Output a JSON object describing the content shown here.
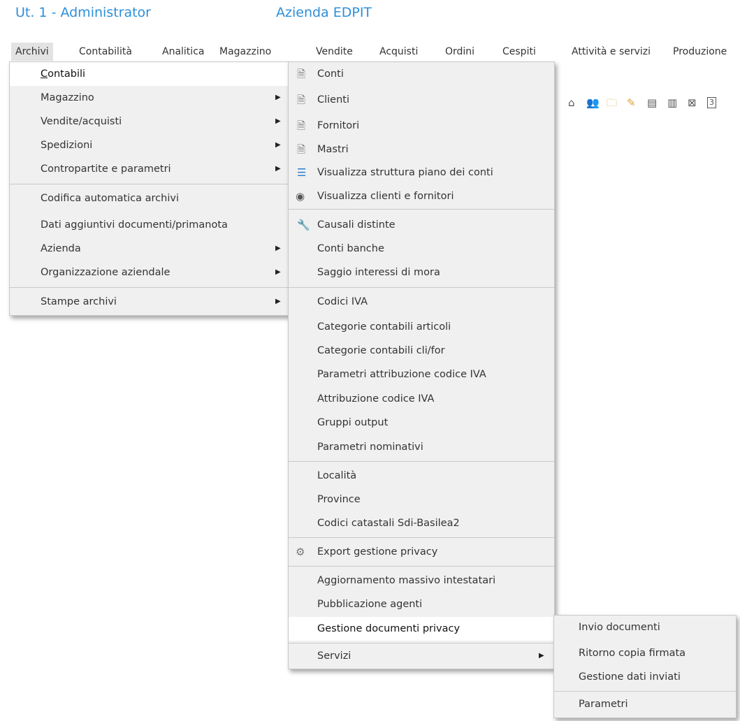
{
  "window": {
    "user_label": "Ut. 1 - Administrator",
    "company_label": "Azienda EDPIT"
  },
  "menubar": {
    "items": [
      {
        "label": "Archivi"
      },
      {
        "label": "Contabilità"
      },
      {
        "label": "Analitica"
      },
      {
        "label": "Magazzino"
      },
      {
        "label": "Vendite"
      },
      {
        "label": "Acquisti"
      },
      {
        "label": "Ordini"
      },
      {
        "label": "Cespiti"
      },
      {
        "label": "Attività e servizi"
      },
      {
        "label": "Produzione"
      }
    ],
    "active": "Archivi"
  },
  "toolbar": {
    "icons": [
      "home-icon",
      "users-icon",
      "search-folder-icon",
      "edit-icon",
      "calculator-icon",
      "barcode-icon",
      "print-icon",
      "calendar-icon"
    ],
    "calendar_text": "3"
  },
  "archivi_menu": {
    "items": [
      {
        "label": "Contabili",
        "submenu": false
      },
      {
        "label": "Magazzino",
        "submenu": true
      },
      {
        "label": "Vendite/acquisti",
        "submenu": true
      },
      {
        "label": "Spedizioni",
        "submenu": true
      },
      {
        "label": "Contropartite e parametri",
        "submenu": true
      },
      {
        "label": "Codifica automatica archivi",
        "submenu": false
      },
      {
        "label": "Dati aggiuntivi documenti/primanota",
        "submenu": false
      },
      {
        "label": "Azienda",
        "submenu": true
      },
      {
        "label": "Organizzazione aziendale",
        "submenu": true
      },
      {
        "label": "Stampe archivi",
        "submenu": true
      }
    ],
    "highlighted": "Contabili"
  },
  "contabili_menu": {
    "items": [
      {
        "label": "Conti",
        "icon": "document-icon"
      },
      {
        "label": "Clienti",
        "icon": "document-icon"
      },
      {
        "label": "Fornitori",
        "icon": "document-icon"
      },
      {
        "label": "Mastri",
        "icon": "document-icon"
      },
      {
        "label": "Visualizza struttura piano dei conti",
        "icon": "tree-icon"
      },
      {
        "label": "Visualizza clienti e fornitori",
        "icon": "eye-icon"
      },
      {
        "label": "Causali distinte",
        "icon": "wrench-icon"
      },
      {
        "label": "Conti banche",
        "icon": ""
      },
      {
        "label": "Saggio interessi di mora",
        "icon": ""
      },
      {
        "label": "Codici IVA",
        "icon": ""
      },
      {
        "label": "Categorie contabili articoli",
        "icon": ""
      },
      {
        "label": "Categorie contabili cli/for",
        "icon": ""
      },
      {
        "label": "Parametri attribuzione codice IVA",
        "icon": ""
      },
      {
        "label": "Attribuzione codice IVA",
        "icon": ""
      },
      {
        "label": "Gruppi output",
        "icon": ""
      },
      {
        "label": "Parametri nominativi",
        "icon": ""
      },
      {
        "label": "Località",
        "icon": ""
      },
      {
        "label": "Province",
        "icon": ""
      },
      {
        "label": "Codici catastali Sdi-Basilea2",
        "icon": ""
      },
      {
        "label": "Export gestione privacy",
        "icon": "gears-icon"
      },
      {
        "label": "Aggiornamento massivo intestatari",
        "icon": ""
      },
      {
        "label": "Pubblicazione agenti",
        "icon": ""
      },
      {
        "label": "Gestione documenti privacy",
        "icon": "",
        "submenu": true
      },
      {
        "label": "Servizi",
        "icon": "",
        "submenu": true
      }
    ],
    "highlighted": "Gestione documenti privacy"
  },
  "privacy_menu": {
    "items": [
      {
        "label": "Invio documenti"
      },
      {
        "label": "Ritorno copia firmata"
      },
      {
        "label": "Gestione dati inviati"
      },
      {
        "label": "Parametri"
      }
    ]
  }
}
